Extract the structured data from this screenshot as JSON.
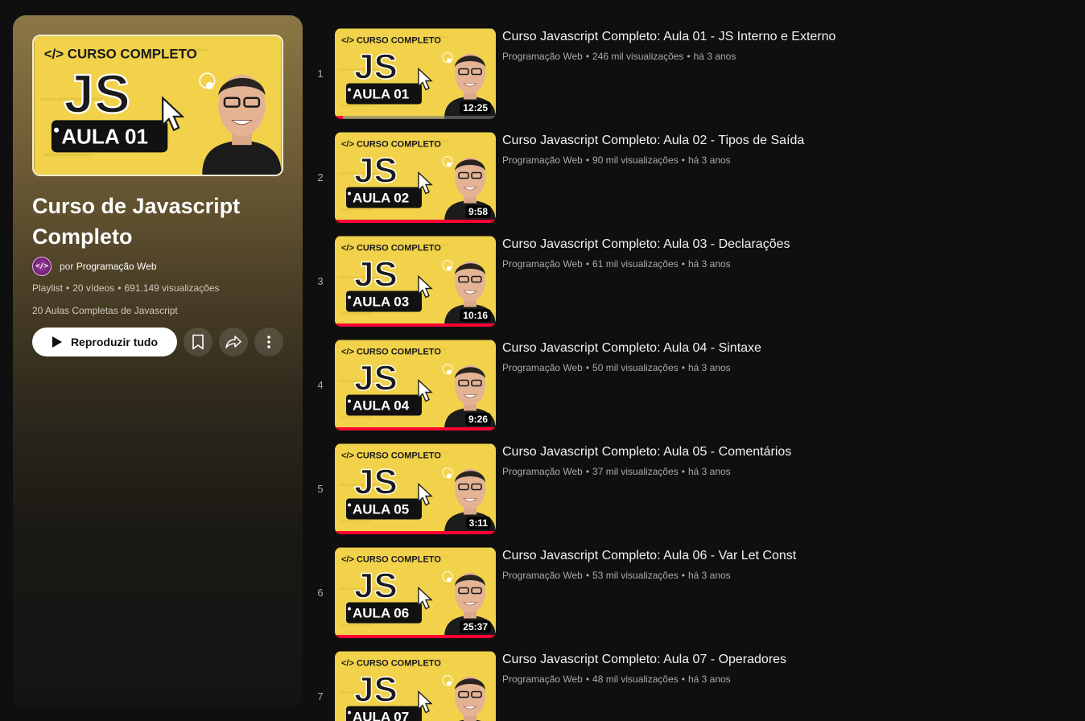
{
  "colors": {
    "accent_yellow": "#f1d24a",
    "progress_red": "#ff0033",
    "background": "#0f0f0f"
  },
  "playlist": {
    "thumbnail": {
      "tagline": "</> CURSO COMPLETO",
      "big_text": "JS",
      "lesson_label": "AULA 01"
    },
    "title": "Curso de Javascript Completo",
    "owner_prefix": "por",
    "owner_name": "Programação Web",
    "avatar_glyph": "</>",
    "meta": {
      "type": "Playlist",
      "videos": "20 vídeos",
      "views": "691.149 visualizações"
    },
    "description": "20 Aulas Completas de Javascript",
    "play_all_label": "Reproduzir tudo",
    "icons": [
      "play-icon",
      "bookmark-icon",
      "share-icon",
      "more-vert-icon"
    ]
  },
  "videos": [
    {
      "index": "1",
      "title": "Curso Javascript Completo: Aula 01 - JS Interno e Externo",
      "channel": "Programação Web",
      "views": "246 mil visualizações",
      "age": "há 3 anos",
      "duration": "12:25",
      "thumb_label": "AULA 01",
      "progress": 0.05
    },
    {
      "index": "2",
      "title": "Curso Javascript Completo: Aula 02 - Tipos de Saída",
      "channel": "Programação Web",
      "views": "90 mil visualizações",
      "age": "há 3 anos",
      "duration": "9:58",
      "thumb_label": "AULA 02",
      "progress": 1.0
    },
    {
      "index": "3",
      "title": "Curso Javascript Completo: Aula 03 - Declarações",
      "channel": "Programação Web",
      "views": "61 mil visualizações",
      "age": "há 3 anos",
      "duration": "10:16",
      "thumb_label": "AULA 03",
      "progress": 1.0
    },
    {
      "index": "4",
      "title": "Curso Javascript Completo: Aula 04 - Sintaxe",
      "channel": "Programação Web",
      "views": "50 mil visualizações",
      "age": "há 3 anos",
      "duration": "9:26",
      "thumb_label": "AULA 04",
      "progress": 1.0
    },
    {
      "index": "5",
      "title": "Curso Javascript Completo: Aula 05 - Comentários",
      "channel": "Programação Web",
      "views": "37 mil visualizações",
      "age": "há 3 anos",
      "duration": "3:11",
      "thumb_label": "AULA 05",
      "progress": 1.0
    },
    {
      "index": "6",
      "title": "Curso Javascript Completo: Aula 06 - Var Let Const",
      "channel": "Programação Web",
      "views": "53 mil visualizações",
      "age": "há 3 anos",
      "duration": "25:37",
      "thumb_label": "AULA 06",
      "progress": 1.0
    },
    {
      "index": "7",
      "title": "Curso Javascript Completo: Aula 07 - Operadores",
      "channel": "Programação Web",
      "views": "48 mil visualizações",
      "age": "há 3 anos",
      "duration": "",
      "thumb_label": "AULA 07",
      "progress": 0
    }
  ]
}
